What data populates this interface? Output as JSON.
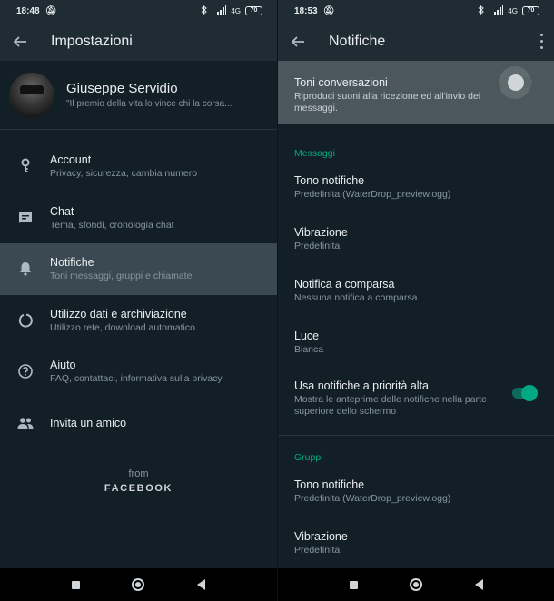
{
  "left": {
    "statusbar": {
      "time": "18:48",
      "battery": "70",
      "signal": "4G"
    },
    "appbar": {
      "title": "Impostazioni"
    },
    "profile": {
      "name": "Giuseppe Servidio",
      "status": "\"Il premio della vita lo vince chi la corsa..."
    },
    "items": [
      {
        "title": "Account",
        "subtitle": "Privacy, sicurezza, cambia numero",
        "icon": "key-icon"
      },
      {
        "title": "Chat",
        "subtitle": "Tema, sfondi, cronologia chat",
        "icon": "chat-icon"
      },
      {
        "title": "Notifiche",
        "subtitle": "Toni messaggi, gruppi e chiamate",
        "icon": "bell-icon"
      },
      {
        "title": "Utilizzo dati e archiviazione",
        "subtitle": "Utilizzo rete, download automatico",
        "icon": "data-usage-icon"
      },
      {
        "title": "Aiuto",
        "subtitle": "FAQ, contattaci, informativa sulla privacy",
        "icon": "help-icon"
      },
      {
        "title": "Invita un amico",
        "icon": "people-icon"
      }
    ],
    "footer": {
      "from": "from",
      "brand": "FACEBOOK"
    }
  },
  "right": {
    "statusbar": {
      "time": "18:53",
      "battery": "70",
      "signal": "4G"
    },
    "appbar": {
      "title": "Notifiche"
    },
    "toni": {
      "title": "Toni conversazioni",
      "subtitle": "Riproduci suoni alla ricezione ed all'invio dei messaggi.",
      "enabled": false
    },
    "messaggi": {
      "header": "Messaggi",
      "tono": {
        "title": "Tono notifiche",
        "value": "Predefinita (WaterDrop_preview.ogg)"
      },
      "vibrazione": {
        "title": "Vibrazione",
        "value": "Predefinita"
      },
      "popup": {
        "title": "Notifica a comparsa",
        "value": "Nessuna notifica a comparsa"
      },
      "luce": {
        "title": "Luce",
        "value": "Bianca"
      },
      "priorita": {
        "title": "Usa notifiche a priorità alta",
        "subtitle": "Mostra le anteprime delle notifiche nella parte superiore dello schermo",
        "enabled": true
      }
    },
    "gruppi": {
      "header": "Gruppi",
      "tono": {
        "title": "Tono notifiche",
        "value": "Predefinita (WaterDrop_preview.ogg)"
      },
      "vibrazione": {
        "title": "Vibrazione",
        "value": "Predefinita"
      }
    }
  },
  "colors": {
    "accent": "#00a884",
    "background": "#131f26",
    "appbar": "#1f2c33",
    "selected": "#3b4a52"
  }
}
